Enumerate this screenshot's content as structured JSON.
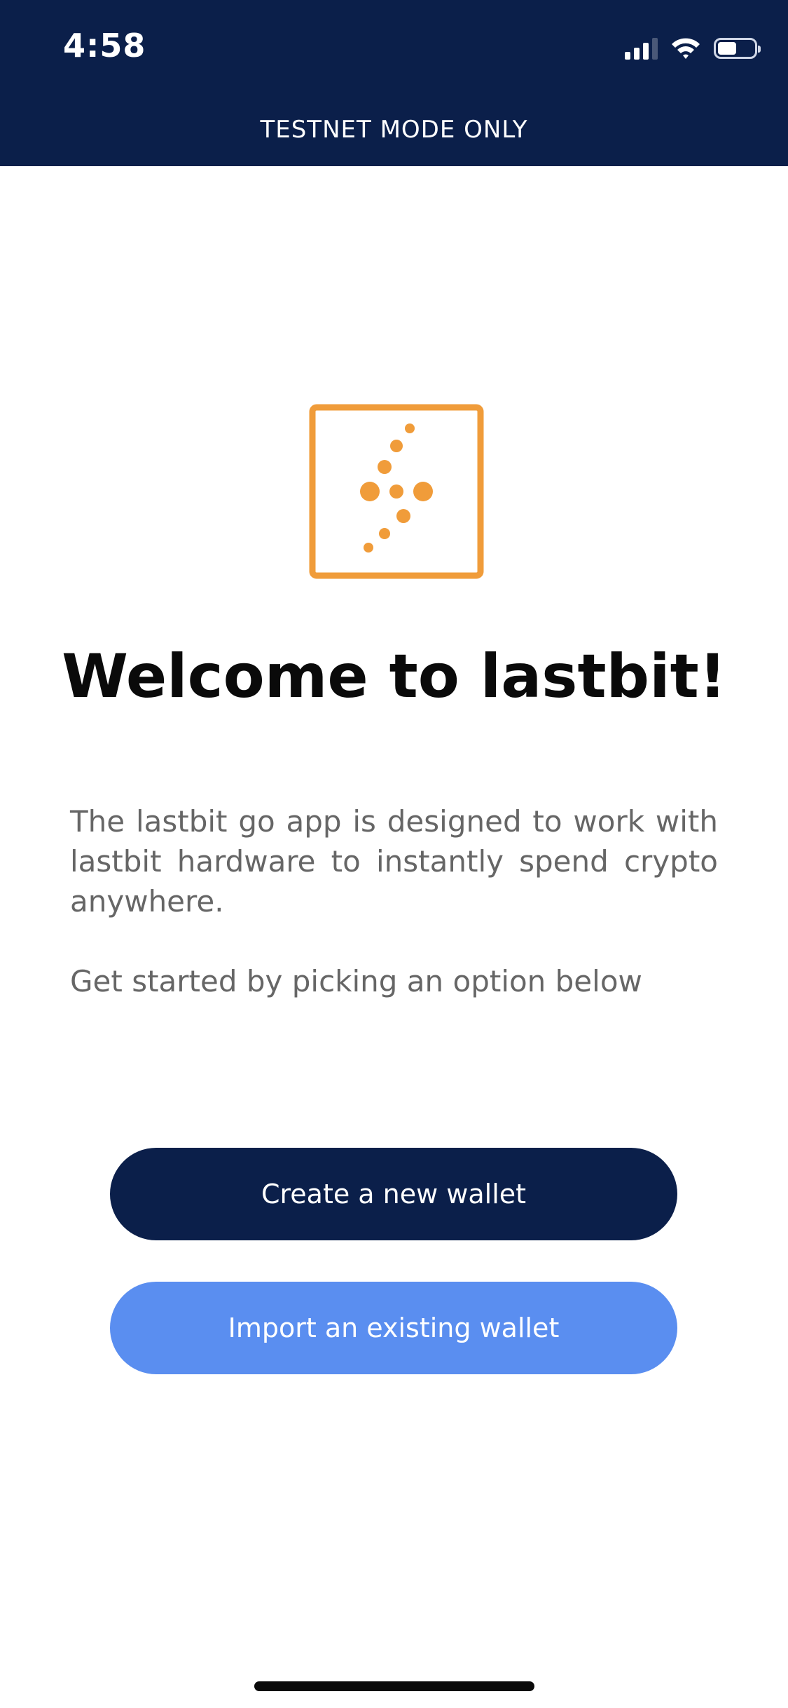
{
  "status_bar": {
    "time": "4:58"
  },
  "banner": {
    "text": "TESTNET MODE ONLY"
  },
  "welcome": {
    "title": "Welcome to lastbit!",
    "description": "The lastbit go app is designed to work with lastbit hardware to instantly spend crypto anywhere.",
    "instruction": "Get started by picking an option below"
  },
  "actions": {
    "create_label": "Create a new wallet",
    "import_label": "Import an existing wallet"
  },
  "colors": {
    "header_bg": "#0b1f4a",
    "logo_accent": "#f09c3a",
    "primary_button": "#0b1f4a",
    "secondary_button": "#5a8ef0"
  },
  "icons": {
    "logo": "lastbit-logo-icon",
    "signal": "cellular-signal-icon",
    "wifi": "wifi-icon",
    "battery": "battery-icon"
  }
}
